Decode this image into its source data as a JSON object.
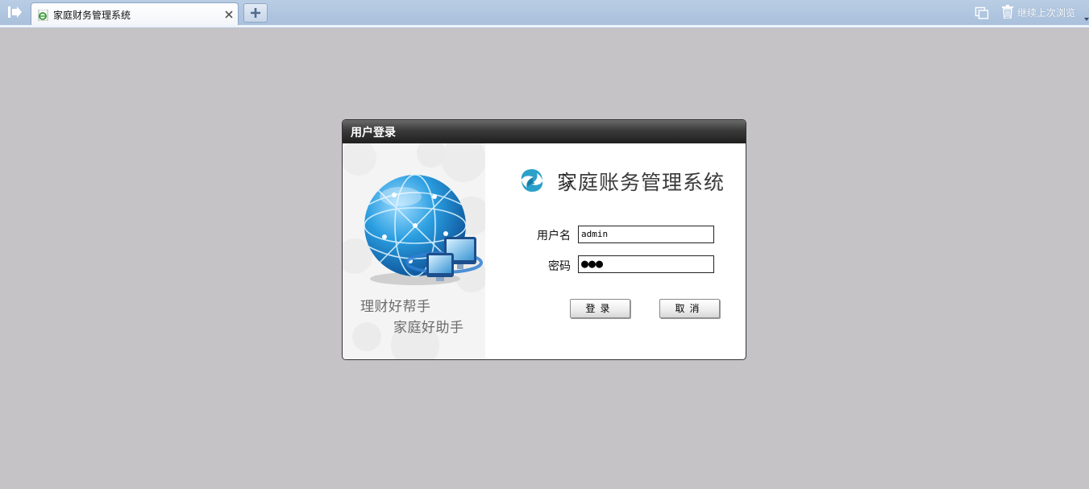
{
  "browser": {
    "tab_title": "家庭财务管理系统",
    "continue_label": "继续上次浏览",
    "icons": {
      "sidebar": "sidebar-toggle-icon",
      "favicon": "ie-page-icon",
      "close": "close-icon",
      "new_tab": "plus-icon",
      "restore": "restore-windows-icon",
      "trash": "trash-icon",
      "dropdown": "chevron-down-icon"
    }
  },
  "dialog": {
    "title": "用户登录",
    "brand_title": "家庭账务管理系统",
    "slogan_line1": "理财好帮手",
    "slogan_line2": "家庭好助手",
    "username_label": "用户名",
    "username_value": "admin",
    "password_label": "密码",
    "password_masked": "●●●",
    "login_button": "登录",
    "cancel_button": "取消",
    "accent_color": "#2b8fd0",
    "header_color": "#2a2a2a"
  }
}
